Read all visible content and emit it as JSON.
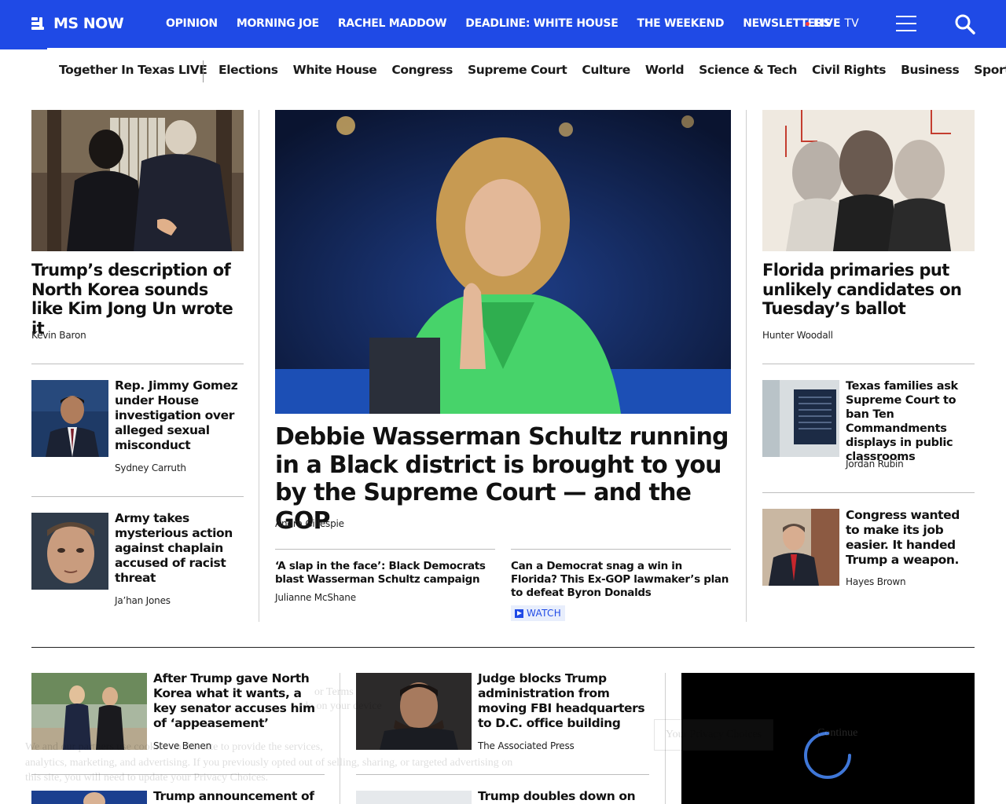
{
  "header": {
    "logo_text": "MS NOW",
    "nav": [
      "OPINION",
      "MORNING JOE",
      "RACHEL MADDOW",
      "DEADLINE: WHITE HOUSE",
      "THE WEEKEND",
      "NEWSLETTERS"
    ],
    "live_label": "LIVE",
    "live_suffix": "TV",
    "colors": {
      "brand": "#1f4ae6",
      "live_dot": "#ff3b3b"
    }
  },
  "subnav": {
    "featured": "Together In Texas LIVE",
    "items": [
      "Elections",
      "White House",
      "Congress",
      "Supreme Court",
      "Culture",
      "World",
      "Science & Tech",
      "Civil Rights",
      "Business",
      "Sports"
    ]
  },
  "left_column": {
    "lead": {
      "headline": "Trump’s description of North Korea sounds like Kim Jong Un wrote it",
      "author": "Kevin Baron"
    },
    "stories": [
      {
        "headline": "Rep. Jimmy Gomez under House investigation over alleged sexual misconduct",
        "author": "Sydney Carruth"
      },
      {
        "headline": "Army takes mysterious action against chaplain accused of racist threat",
        "author": "Ja’han Jones"
      }
    ]
  },
  "center_column": {
    "hero": {
      "headline": "Debbie Wasserman Schultz running in a Black district is brought to you by the Supreme Court — and the GOP",
      "author": "Andra Gillespie"
    },
    "related": [
      {
        "headline": "‘A slap in the face’: Black Democrats blast Wasserman Schultz campaign",
        "author": "Julianne McShane"
      },
      {
        "headline": "Can a Democrat snag a win in Florida? This Ex-GOP lawmaker’s plan to defeat Byron Donalds",
        "badge": "WATCH"
      }
    ]
  },
  "right_column": {
    "lead": {
      "headline": "Florida primaries put unlikely candidates on Tuesday’s ballot",
      "author": "Hunter Woodall"
    },
    "stories": [
      {
        "headline": "Texas families ask Supreme Court to ban Ten Commandments displays in public classrooms",
        "author": "Jordan Rubin"
      },
      {
        "headline": "Congress wanted to make its job easier. It handed Trump a weapon.",
        "author": "Hayes Brown"
      }
    ]
  },
  "lower_row": {
    "col1": [
      {
        "headline": "After Trump gave North Korea what it wants, a key senator accuses him of ‘appeasement’",
        "author": "Steve Benen"
      },
      {
        "headline": "Trump announcement of"
      }
    ],
    "col2": [
      {
        "headline": "Judge blocks Trump administration from moving FBI headquarters to D.C. office building",
        "author": "The Associated Press"
      },
      {
        "headline": "Trump doubles down on idea"
      }
    ]
  },
  "consent": {
    "line1": "We and our partners use cookies on this site to provide the services,",
    "line2": "analytics, marketing, and advertising. If you previously opted out of selling, sharing, or targeted advertising on",
    "line3": "this site, you will need to update your Privacy Choices.",
    "frag_top1": "or Terms",
    "frag_top2": "do on your device",
    "privacy_button": "Your Privacy Choices",
    "continue_button": "Continue"
  }
}
